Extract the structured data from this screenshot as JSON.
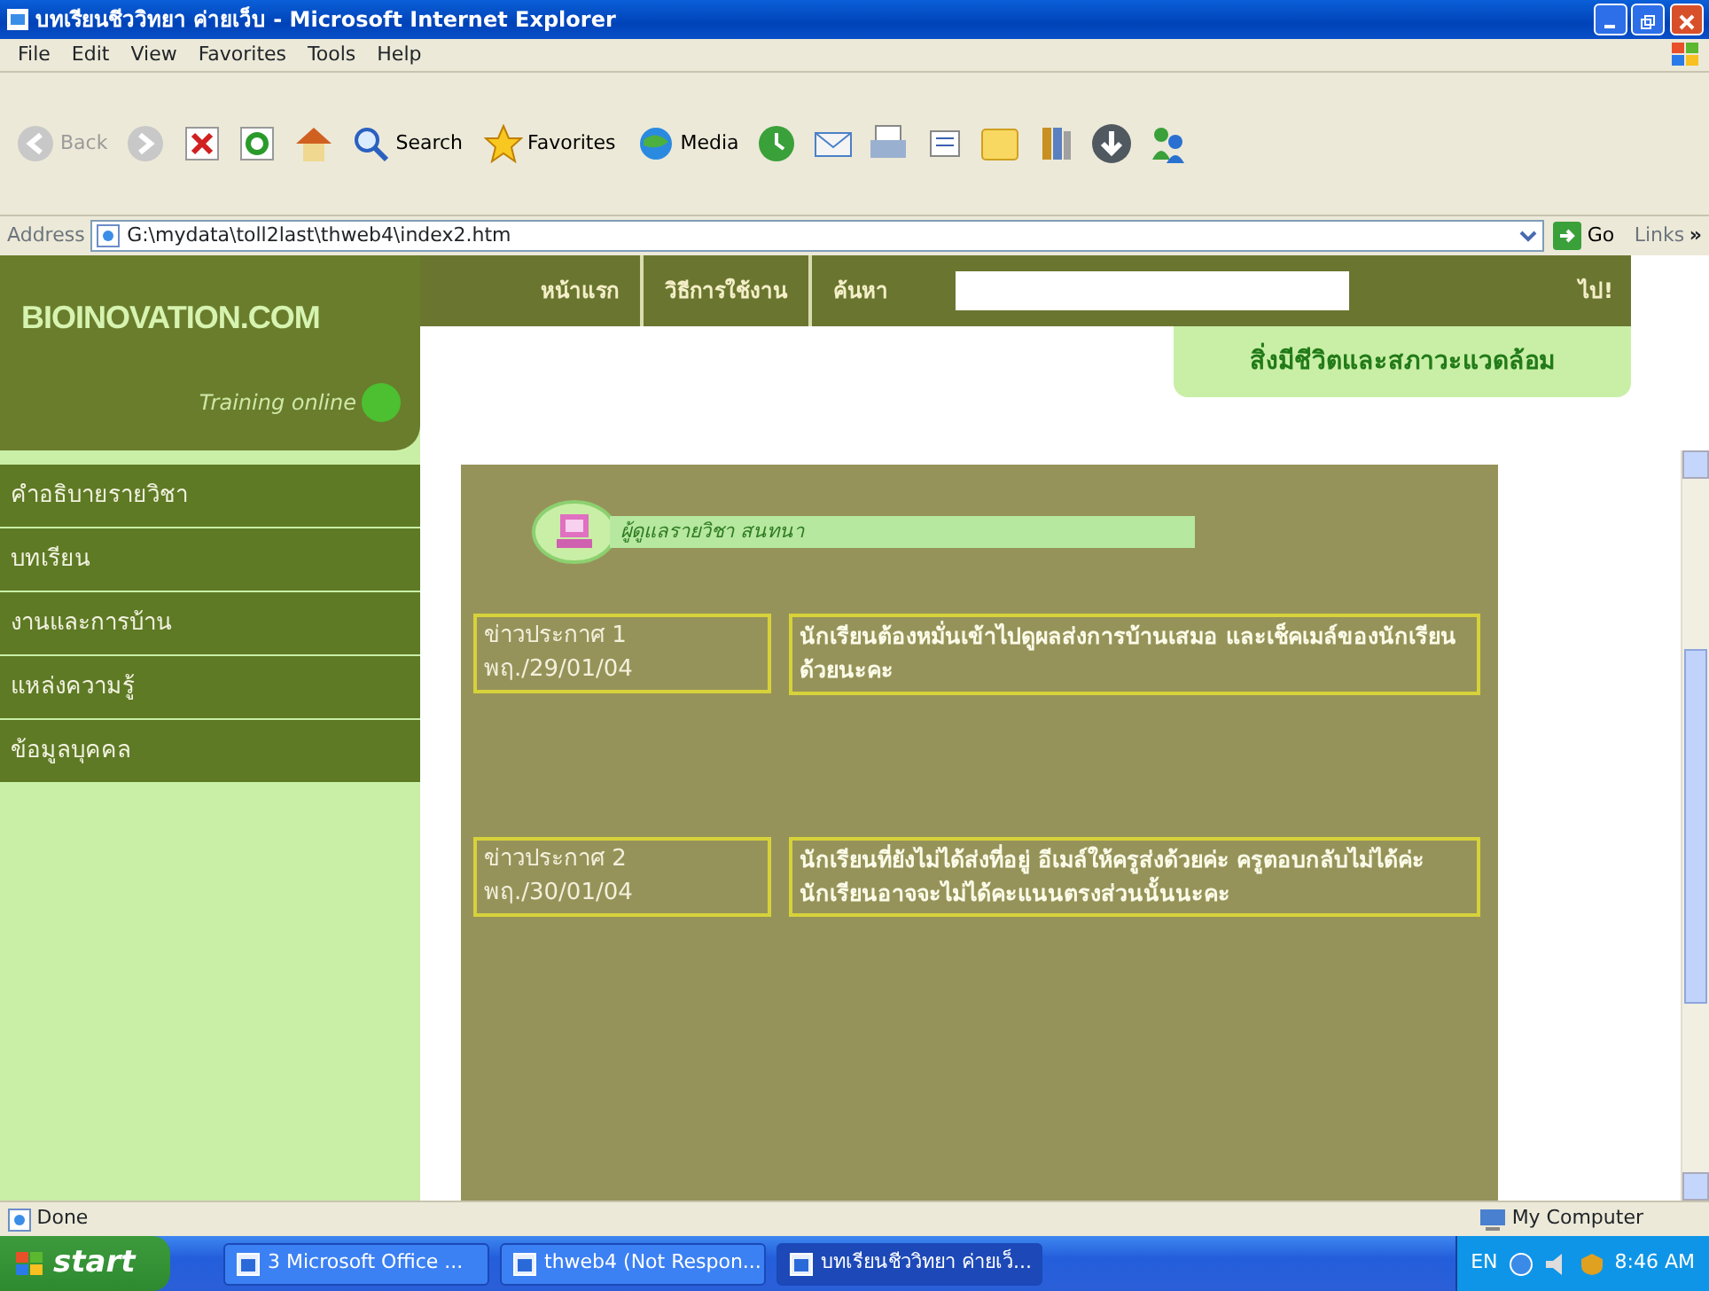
{
  "window": {
    "title": "บทเรียนชีววิทยา ค่ายเว็บ - Microsoft Internet Explorer"
  },
  "menu_bar": [
    "File",
    "Edit",
    "View",
    "Favorites",
    "Tools",
    "Help"
  ],
  "toolbar": [
    {
      "label": "Back",
      "disabled": true
    },
    {
      "label": "Search",
      "disabled": false
    },
    {
      "label": "Favorites",
      "disabled": false
    },
    {
      "label": "Media",
      "disabled": false
    }
  ],
  "address_bar": {
    "label": "Address",
    "value": "G:\\mydata\\toll2last\\thweb4\\index2.htm",
    "go": "Go",
    "links": "Links",
    "more": "»"
  },
  "page": {
    "logo": "BIOINOVATION.COM",
    "tagline": "Training online",
    "nav": [
      "หน้าแรก",
      "วิธีการใช้งาน",
      "ค้นหา"
    ],
    "search_button": "ไป!",
    "subject": "สิ่งมีชีวิตและสภาวะแวดล้อม",
    "sidebar": [
      "คำอธิบายรายวิชา",
      "บทเรียน",
      "งานและการบ้าน",
      "แหล่งความรู้",
      "ข้อมูลบุคคล"
    ],
    "panel_title": "ผู้ดูแลรายวิชา สนทนา",
    "announcements": [
      {
        "title": "ข่าวประกาศ 1",
        "date": "พฤ./29/01/04",
        "text": "นักเรียนต้องหมั่นเข้าไปดูผลส่งการบ้านเสมอ  และเช็คเมล์ของนักเรียน ด้วยนะคะ"
      },
      {
        "title": "ข่าวประกาศ 2",
        "date": "พฤ./30/01/04",
        "text": "นักเรียนที่ยังไม่ได้ส่งที่อยู่ อีเมล์ให้ครูส่งด้วยค่ะ ครูตอบกลับไม่ได้ค่ะ นักเรียนอาจจะไม่ได้คะแนนตรงส่วนนั้นนะคะ"
      }
    ]
  },
  "status_bar": {
    "text": "Done",
    "zone": "My Computer"
  },
  "taskbar": {
    "start": "start",
    "tasks": [
      {
        "label": "3 Microsoft Office ...",
        "selected": false
      },
      {
        "label": "thweb4 (Not Respon...",
        "selected": false
      },
      {
        "label": "บทเรียนชีววิทยา ค่ายเว็...",
        "selected": true
      }
    ],
    "language": "EN",
    "clock": "8:46 AM"
  }
}
